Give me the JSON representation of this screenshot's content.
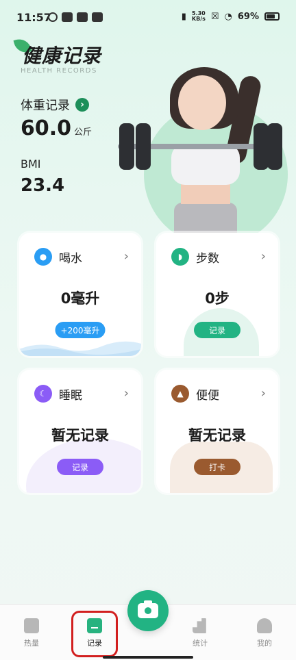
{
  "status_bar": {
    "time": "11:57",
    "speed_value": "5.30",
    "speed_unit": "KB/s",
    "battery": "69%"
  },
  "header": {
    "title": "健康记录",
    "subtitle": "HEALTH RECORDS"
  },
  "weight": {
    "title": "体重记录",
    "value": "60.0",
    "unit": "公斤",
    "bmi_label": "BMI",
    "bmi_value": "23.4"
  },
  "cards": {
    "water": {
      "title": "喝水",
      "value": "0毫升",
      "button": "+200毫升",
      "color": "#2a9df4"
    },
    "steps": {
      "title": "步数",
      "value": "0步",
      "button": "记录",
      "color": "#22b383"
    },
    "sleep": {
      "title": "睡眠",
      "value": "暂无记录",
      "button": "记录",
      "color": "#8b5cf6"
    },
    "poop": {
      "title": "便便",
      "value": "暂无记录",
      "button": "打卡",
      "color": "#9a5a2f"
    }
  },
  "tabbar": {
    "items": [
      {
        "label": "热量",
        "icon": "scale-icon"
      },
      {
        "label": "记录",
        "icon": "edit-icon",
        "active": true
      },
      {
        "label": "统计",
        "icon": "bar-chart-icon"
      },
      {
        "label": "我的",
        "icon": "user-icon"
      }
    ],
    "fab_icon": "camera-icon"
  }
}
